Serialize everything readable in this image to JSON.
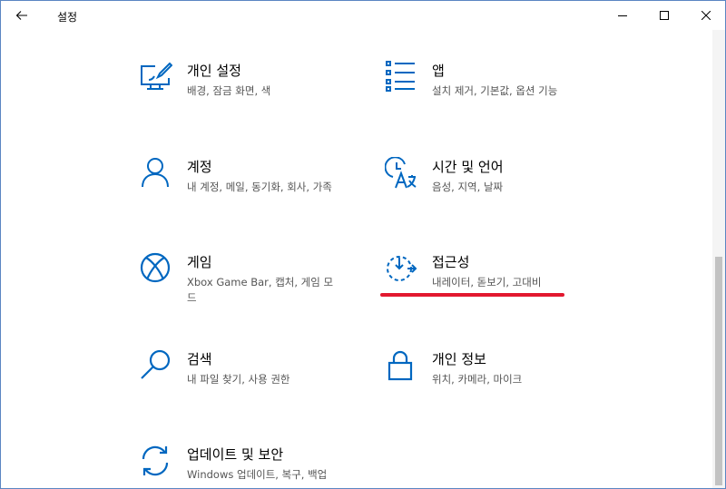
{
  "window": {
    "title": "설정",
    "accent": "#0067c0"
  },
  "tiles": [
    {
      "name": "개인 설정",
      "desc": "배경, 잠금 화면, 색",
      "icon": "personalization-icon"
    },
    {
      "name": "앱",
      "desc": "설치 제거, 기본값, 옵션 기능",
      "icon": "apps-icon"
    },
    {
      "name": "계정",
      "desc": "내 계정, 메일, 동기화, 회사, 가족",
      "icon": "account-icon"
    },
    {
      "name": "시간 및 언어",
      "desc": "음성, 지역, 날짜",
      "icon": "time-language-icon"
    },
    {
      "name": "게임",
      "desc": "Xbox Game Bar, 캡처, 게임 모드",
      "icon": "xbox-icon"
    },
    {
      "name": "접근성",
      "desc": "내레이터, 돋보기, 고대비",
      "icon": "ease-of-access-icon"
    },
    {
      "name": "검색",
      "desc": "내 파일 찾기, 사용 권한",
      "icon": "search-icon"
    },
    {
      "name": "개인 정보",
      "desc": "위치, 카메라, 마이크",
      "icon": "lock-icon"
    },
    {
      "name": "업데이트 및 보안",
      "desc": "Windows 업데이트, 복구, 백업",
      "icon": "update-icon"
    }
  ],
  "annotation": {
    "color": "#e2182f"
  }
}
